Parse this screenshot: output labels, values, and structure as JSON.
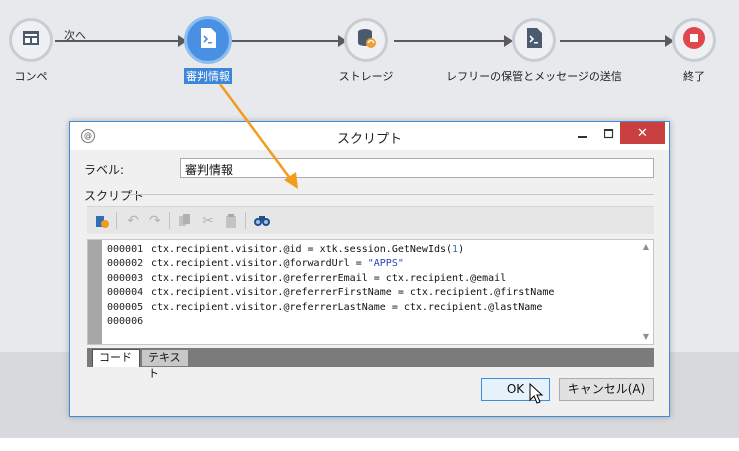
{
  "workflow": {
    "transition_label": "次へ",
    "nodes": [
      {
        "label": "コンペ",
        "icon": "form-icon"
      },
      {
        "label": "審判情報",
        "icon": "script-icon",
        "selected": true
      },
      {
        "label": "ストレージ",
        "icon": "database-sync-icon"
      },
      {
        "label": "レフリーの保管とメッセージの送信",
        "icon": "script-icon"
      },
      {
        "label": "終了",
        "icon": "stop-icon"
      }
    ]
  },
  "dialog": {
    "title": "スクリプト",
    "label_caption": "ラベル:",
    "label_value": "審判情報",
    "script_section": "スクリプト",
    "toolbar": [
      "script-object-icon",
      "undo-icon",
      "redo-icon",
      "copy-icon",
      "cut-icon",
      "paste-icon",
      "find-icon"
    ],
    "code": [
      {
        "line": "000001",
        "text": "ctx.recipient.visitor.@id = xtk.session.GetNewIds(",
        "num": "1",
        "tail": ")"
      },
      {
        "line": "000002",
        "text": "ctx.recipient.visitor.@forwardUrl = ",
        "str": "\"APPS\"",
        "tail": ""
      },
      {
        "line": "000003",
        "text": "ctx.recipient.visitor.@referrerEmail = ctx.recipient.@email",
        "tail": ""
      },
      {
        "line": "000004",
        "text": "ctx.recipient.visitor.@referrerFirstName = ctx.recipient.@firstName",
        "tail": ""
      },
      {
        "line": "000005",
        "text": "ctx.recipient.visitor.@referrerLastName = ctx.recipient.@lastName",
        "tail": ""
      },
      {
        "line": "000006",
        "text": "",
        "tail": ""
      }
    ],
    "tabs": {
      "code": "コード",
      "text": "テキスト"
    },
    "ok_label": "OK",
    "cancel_label": "キャンセル(A)"
  },
  "colors": {
    "accent": "#3c8dde",
    "selected_node": "#4a90e2",
    "arrow": "#f29b1d",
    "close": "#c84040"
  }
}
